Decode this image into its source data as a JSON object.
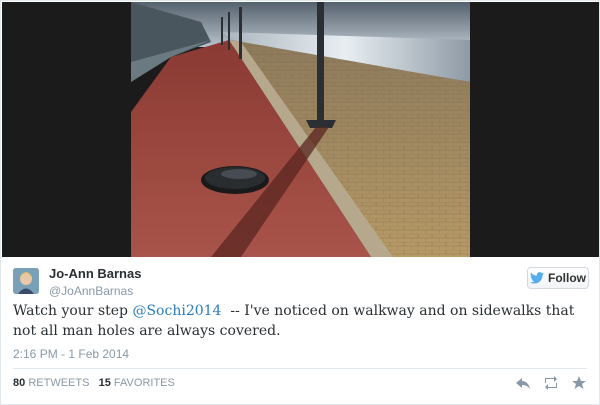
{
  "user": {
    "name": "Jo-Ann Barnas",
    "handle": "@JoAnnBarnas"
  },
  "follow_button": {
    "label": "Follow",
    "icon": "twitter-bird-icon"
  },
  "tweet": {
    "text_before": "Watch your step ",
    "mention": "@Sochi2014",
    "text_after": "  -- I've noticed on walkway and on sidewalks that not all man holes are always covered.",
    "timestamp": "2:16 PM - 1 Feb 2014"
  },
  "stats": {
    "retweets_count": "80",
    "retweets_label": "RETWEETS",
    "favorites_count": "15",
    "favorites_label": "FAVORITES"
  },
  "actions": [
    "reply-icon",
    "retweet-icon",
    "favorite-icon"
  ],
  "colors": {
    "link": "#2b7bb9",
    "muted": "#8899a6",
    "text": "#292f33",
    "bird": "#55acee"
  }
}
